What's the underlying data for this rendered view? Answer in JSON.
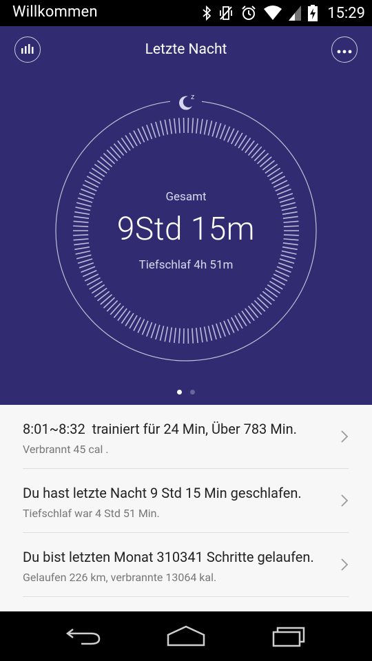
{
  "statusbar": {
    "title": "Willkommen",
    "time": "15:29",
    "icons": [
      "bluetooth-icon",
      "vibrate-off-icon",
      "alarm-icon",
      "wifi-icon",
      "signal-icon",
      "battery-charging-icon"
    ]
  },
  "header": {
    "title": "Letzte Nacht",
    "left_icon": "bar-chart-icon",
    "right_icon": "more-icon"
  },
  "summary": {
    "label": "Gesamt",
    "total": "9Std 15m",
    "deep": "Tiefschlaf 4h 51m",
    "moon_icon": "moon-sleep-icon"
  },
  "pager": {
    "count": 2,
    "active": 0
  },
  "feed": [
    {
      "main": "8:01~8:32  trainiert für 24 Min, Über 783 Min.",
      "sub": "Verbrannt 45 cal ."
    },
    {
      "main": "Du hast letzte Nacht 9 Std 15 Min geschlafen.",
      "sub": "Tiefschlaf war 4 Std 51 Min."
    },
    {
      "main": "Du bist letzten Monat 310341 Schritte gelaufen.",
      "sub": "Gelaufen 226 km, verbrannte 13064 kal."
    }
  ],
  "colors": {
    "hero_bg": "#312c71",
    "list_bg": "#f7f7f7"
  }
}
